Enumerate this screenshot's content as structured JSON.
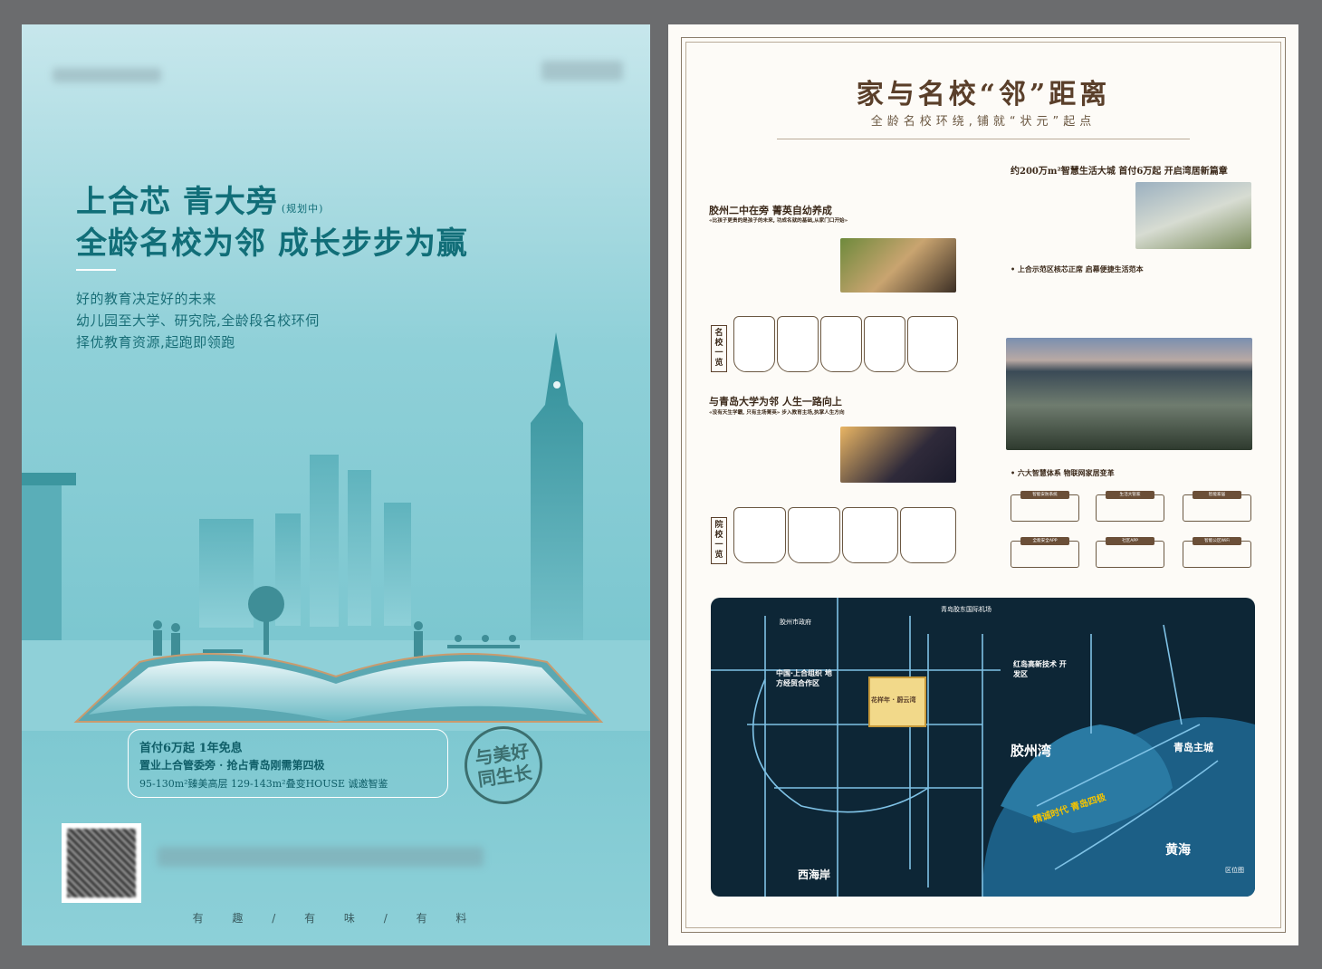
{
  "left": {
    "headline_1": "上合芯 青大旁",
    "headline_1_note": "(规划中)",
    "headline_2": "全龄名校为邻 成长步步为赢",
    "tagline_1": "好的教育决定好的未来",
    "tagline_2": "幼儿园至大学、研究院,全龄段名校环伺",
    "tagline_3": "择优教育资源,起跑即领跑",
    "promo_1": "首付6万起 1年免息",
    "promo_2": "置业上合管委旁 · 抢占青岛刚需第四极",
    "promo_3": "95-130m²臻美高层 129-143m²叠变HOUSE 诚邀智鉴",
    "stamp": "与美好 同生长",
    "footer": "有 趣 / 有 味 / 有 料"
  },
  "right": {
    "title": "家与名校“邻”距离",
    "subtitle": "全龄名校环绕,铺就“状元”起点",
    "col1": {
      "section_a_title": "胶州二中在旁 菁英自幼养成",
      "section_a_note": "«比孩子更贵的是孩子的未来, 功成名就的基础,从家门口开始»",
      "tag_a": "名校一览",
      "section_b_title": "与青岛大学为邻 人生一路向上",
      "section_b_note": "«没有天生学霸, 只有主场菁英» 步入教育主场,执掌人生方向",
      "tag_b": "院校一览"
    },
    "col2": {
      "section_a_title": "约200万m²智慧生活大城 首付6万起 开启湾居新篇章",
      "section_b_title": "• 上合示范区核芯正席 启幕便捷生活范本",
      "section_c_title": "• 六大智慧体系 物联网家居变革",
      "smart": [
        "智能安防系统",
        "生活大管家",
        "智能家居",
        "全能安全APP",
        "社区APP",
        "智能公区WiFi"
      ]
    },
    "map": {
      "jiaozhou_bay": "胶州湾",
      "qingdao_main": "青岛主城",
      "west_coast": "西海岸",
      "yellow_sea": "黄海",
      "sco_zone": "中国·上合组织 地方经贸合作区",
      "hongdao": "红岛高新技术 开发区",
      "project": "花样年 · 蔚云湾",
      "highway": "精诚时代 青岛四极",
      "gov": "胶州市政府",
      "station": "青岛胶东国际机场",
      "legend": "区位图"
    }
  }
}
